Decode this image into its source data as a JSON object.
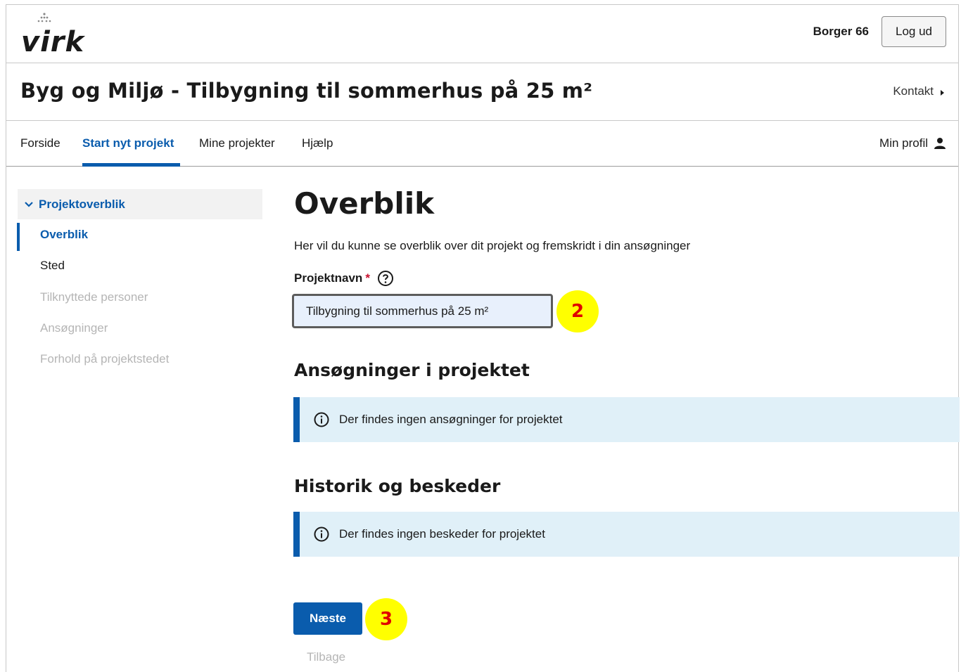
{
  "header": {
    "logo_text": "virk",
    "user_name": "Borger 66",
    "logout_label": "Log ud"
  },
  "titlebar": {
    "title": "Byg og Miljø - Tilbygning til sommerhus på 25 m²",
    "contact_label": "Kontakt"
  },
  "nav": {
    "items": [
      {
        "label": "Forside"
      },
      {
        "label": "Start nyt projekt",
        "active": true
      },
      {
        "label": "Mine projekter"
      },
      {
        "label": "Hjælp"
      }
    ],
    "profile_label": "Min profil"
  },
  "sidebar": {
    "section_label": "Projektoverblik",
    "items": [
      {
        "label": "Overblik",
        "state": "active"
      },
      {
        "label": "Sted",
        "state": "normal"
      },
      {
        "label": "Tilknyttede personer",
        "state": "disabled"
      },
      {
        "label": "Ansøgninger",
        "state": "disabled"
      },
      {
        "label": "Forhold på projektstedet",
        "state": "disabled"
      }
    ]
  },
  "main": {
    "heading": "Overblik",
    "intro": "Her vil du kunne se overblik over dit projekt og fremskridt i din ansøgninger",
    "project_name_label": "Projektnavn",
    "required_mark": "*",
    "project_name_value": "Tilbygning til sommerhus på 25 m²",
    "applications_heading": "Ansøgninger i projektet",
    "applications_info": "Der findes ingen ansøgninger for projektet",
    "history_heading": "Historik og beskeder",
    "history_info": "Der findes ingen beskeder for projektet",
    "next_label": "Næste",
    "back_label": "Tilbage"
  },
  "markers": {
    "field_marker": "2",
    "button_marker": "3"
  },
  "colors": {
    "accent": "#0a5cad",
    "info_bg": "#e0f0f8",
    "marker_bg": "#ffff00",
    "marker_text": "#e00000",
    "required": "#c8102e"
  }
}
